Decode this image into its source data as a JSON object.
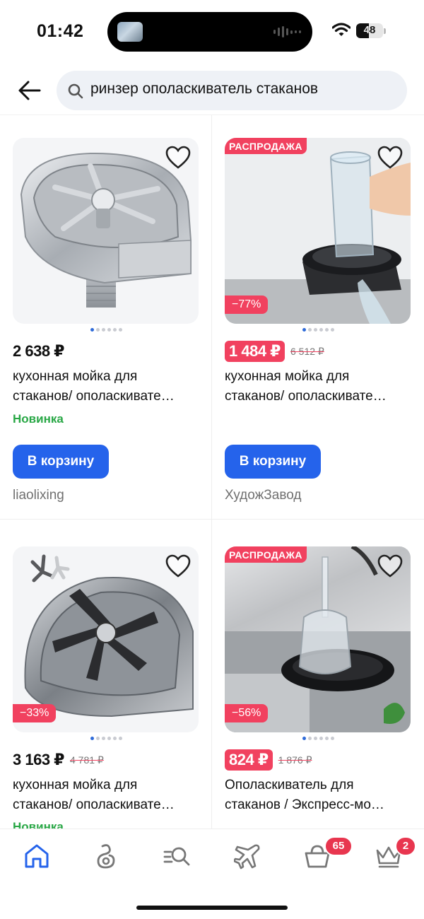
{
  "status_bar": {
    "time": "01:42",
    "battery": "48",
    "battery_level": 0.48
  },
  "header": {
    "search_query": "ринзер ополаскиватель стаканов"
  },
  "products": [
    {
      "sale_badge": "",
      "discount": "",
      "price": "2 638 ₽",
      "old_price": "",
      "name_line1": "кухонная мойка для",
      "name_line2": "стаканов/ ополаскивате…",
      "tag": "Новинка",
      "cart_label": "В корзину",
      "seller": "liaolixing"
    },
    {
      "sale_badge": "РАСПРОДАЖА",
      "discount": "−77%",
      "price": "1 484 ₽",
      "old_price": "6 512 ₽",
      "name_line1": "кухонная мойка для",
      "name_line2": "стаканов/ ополаскивате…",
      "tag": "",
      "cart_label": "В корзину",
      "seller": "ХудожЗавод"
    },
    {
      "sale_badge": "",
      "discount": "−33%",
      "price": "3 163 ₽",
      "old_price": "4 781 ₽",
      "name_line1": "кухонная мойка для",
      "name_line2": "стаканов/ ополаскивате…",
      "tag": "Новинка",
      "cart_label": "",
      "seller": ""
    },
    {
      "sale_badge": "РАСПРОДАЖА",
      "discount": "−56%",
      "price": "824 ₽",
      "old_price": "1 876 ₽",
      "name_line1": "Ополаскиватель для",
      "name_line2": "стаканов / Экспресс-мо…",
      "tag": "",
      "cart_label": "",
      "seller": ""
    }
  ],
  "bottom_nav": {
    "items": [
      "home-icon",
      "feed-icon",
      "catalog-search-icon",
      "travel-icon",
      "cart-icon",
      "crown-icon"
    ],
    "cart_badge": "65",
    "crown_badge": "2"
  },
  "colors": {
    "accent": "#2563eb",
    "sale": "#f1415f",
    "new": "#28a745"
  }
}
